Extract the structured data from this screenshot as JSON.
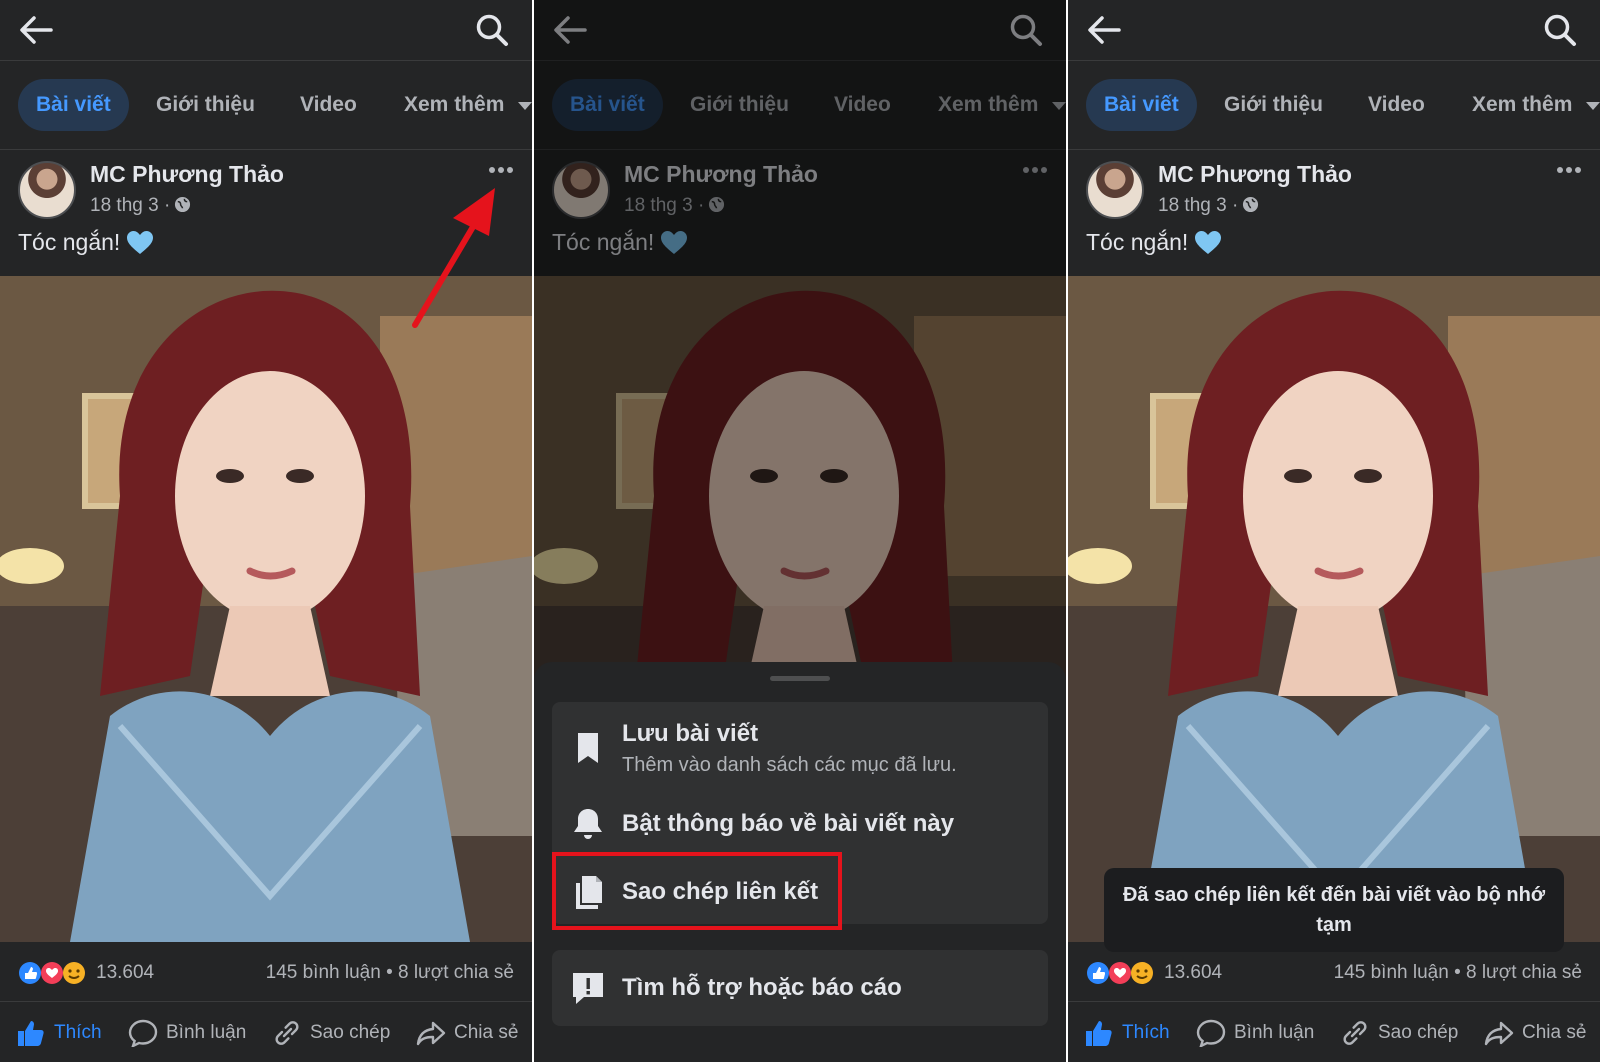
{
  "tabs": {
    "posts": "Bài viết",
    "about": "Giới thiệu",
    "video": "Video",
    "more": "Xem thêm"
  },
  "post": {
    "author": "MC Phương Thảo",
    "date": "18 thg 3 ·",
    "caption": "Tóc ngắn!",
    "reaction_count": "13.604",
    "stats": "145 bình luận • 8 lượt chia sẻ"
  },
  "actions": {
    "like": "Thích",
    "comment": "Bình luận",
    "copy": "Sao chép",
    "share": "Chia sẻ"
  },
  "menu": {
    "save_title": "Lưu bài viết",
    "save_sub": "Thêm vào danh sách các mục đã lưu.",
    "notify": "Bật thông báo về bài viết này",
    "copy_link": "Sao chép liên kết",
    "report": "Tìm hỗ trợ hoặc báo cáo"
  },
  "toast": "Đã sao chép liên kết đến bài viết vào bộ nhớ tạm",
  "colors": {
    "background": "#242526",
    "tab_active_bg": "#263951",
    "accent_blue": "#2d88ff",
    "highlight_red": "#e5131c"
  }
}
